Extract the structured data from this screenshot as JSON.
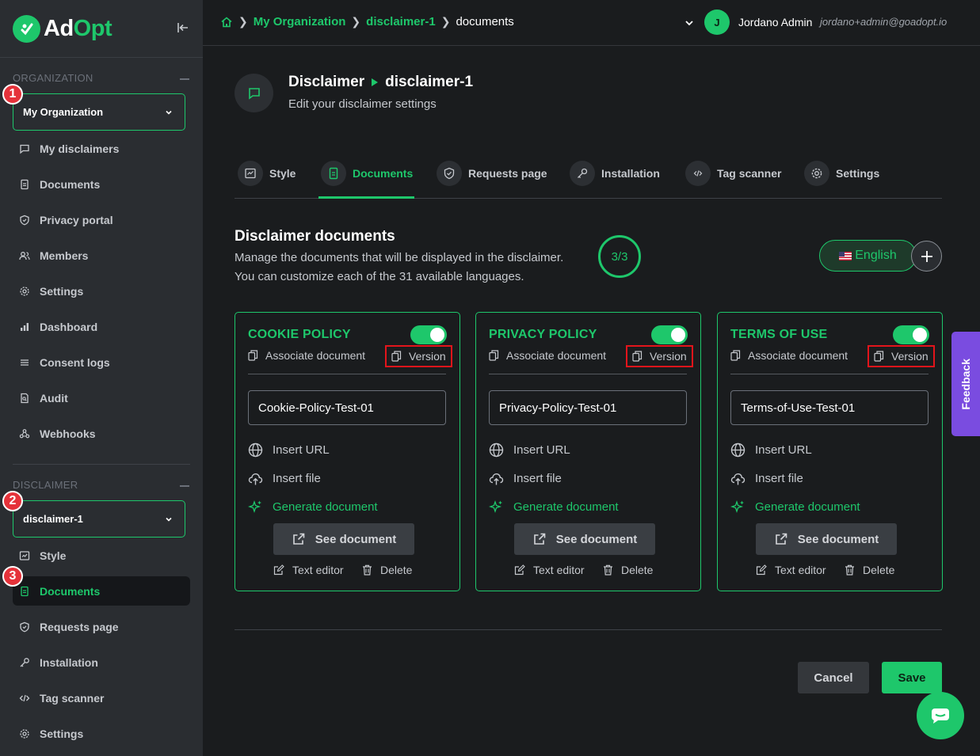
{
  "app": {
    "logo_prefix": "Ad",
    "logo_suffix": "Opt"
  },
  "sidebar": {
    "org_section_label": "ORGANIZATION",
    "org_selected": "My Organization",
    "org_items": [
      {
        "label": "My disclaimers",
        "icon": "message-square-icon"
      },
      {
        "label": "Documents",
        "icon": "file-icon"
      },
      {
        "label": "Privacy portal",
        "icon": "shield-icon"
      },
      {
        "label": "Members",
        "icon": "users-icon"
      },
      {
        "label": "Settings",
        "icon": "gear-icon"
      },
      {
        "label": "Dashboard",
        "icon": "bar-chart-icon"
      },
      {
        "label": "Consent logs",
        "icon": "list-icon"
      },
      {
        "label": "Audit",
        "icon": "file-search-icon"
      },
      {
        "label": "Webhooks",
        "icon": "webhook-icon"
      }
    ],
    "disclaimer_section_label": "DISCLAIMER",
    "disclaimer_selected": "disclaimer-1",
    "disclaimer_items": [
      {
        "label": "Style",
        "icon": "style-icon"
      },
      {
        "label": "Documents",
        "icon": "file-icon",
        "active": true
      },
      {
        "label": "Requests page",
        "icon": "shield-icon"
      },
      {
        "label": "Installation",
        "icon": "key-icon"
      },
      {
        "label": "Tag scanner",
        "icon": "code-icon"
      },
      {
        "label": "Settings",
        "icon": "gear-icon"
      }
    ],
    "annotation_badges": [
      "1",
      "2",
      "3"
    ]
  },
  "topbar": {
    "breadcrumb": [
      "My Organization",
      "disclaimer-1",
      "documents"
    ],
    "avatar_initial": "J",
    "user_name": "Jordano Admin",
    "user_email": "jordano+admin@goadopt.io"
  },
  "header": {
    "title": "Disclaimer",
    "title_sub": "disclaimer-1",
    "subtitle": "Edit your disclaimer settings"
  },
  "tabs": [
    {
      "label": "Style"
    },
    {
      "label": "Documents",
      "active": true
    },
    {
      "label": "Requests page"
    },
    {
      "label": "Installation"
    },
    {
      "label": "Tag scanner"
    },
    {
      "label": "Settings"
    }
  ],
  "documents_section": {
    "title": "Disclaimer documents",
    "desc_line1": "Manage the documents that will be displayed in the disclaimer.",
    "desc_line2": "You can customize each of the 31 available languages.",
    "counter": "3/3",
    "language": "English"
  },
  "cards": [
    {
      "title": "COOKIE POLICY",
      "enabled": true,
      "associate": "Associate document",
      "version": "Version",
      "doc_name": "Cookie-Policy-Test-01",
      "insert_url": "Insert URL",
      "insert_file": "Insert file",
      "generate": "Generate document",
      "see": "See document",
      "text_editor": "Text editor",
      "delete": "Delete"
    },
    {
      "title": "PRIVACY POLICY",
      "enabled": true,
      "associate": "Associate document",
      "version": "Version",
      "doc_name": "Privacy-Policy-Test-01",
      "insert_url": "Insert URL",
      "insert_file": "Insert file",
      "generate": "Generate document",
      "see": "See document",
      "text_editor": "Text editor",
      "delete": "Delete"
    },
    {
      "title": "TERMS OF USE",
      "enabled": true,
      "associate": "Associate document",
      "version": "Version",
      "doc_name": "Terms-of-Use-Test-01",
      "insert_url": "Insert URL",
      "insert_file": "Insert file",
      "generate": "Generate document",
      "see": "See document",
      "text_editor": "Text editor",
      "delete": "Delete"
    }
  ],
  "actions": {
    "cancel": "Cancel",
    "save": "Save"
  },
  "feedback_label": "Feedback",
  "colors": {
    "accent": "#1ec76b",
    "sidebar": "#2a2d31",
    "background": "#1a1c1e",
    "highlight": "#e3141b",
    "feedback": "#7a4ce0"
  }
}
